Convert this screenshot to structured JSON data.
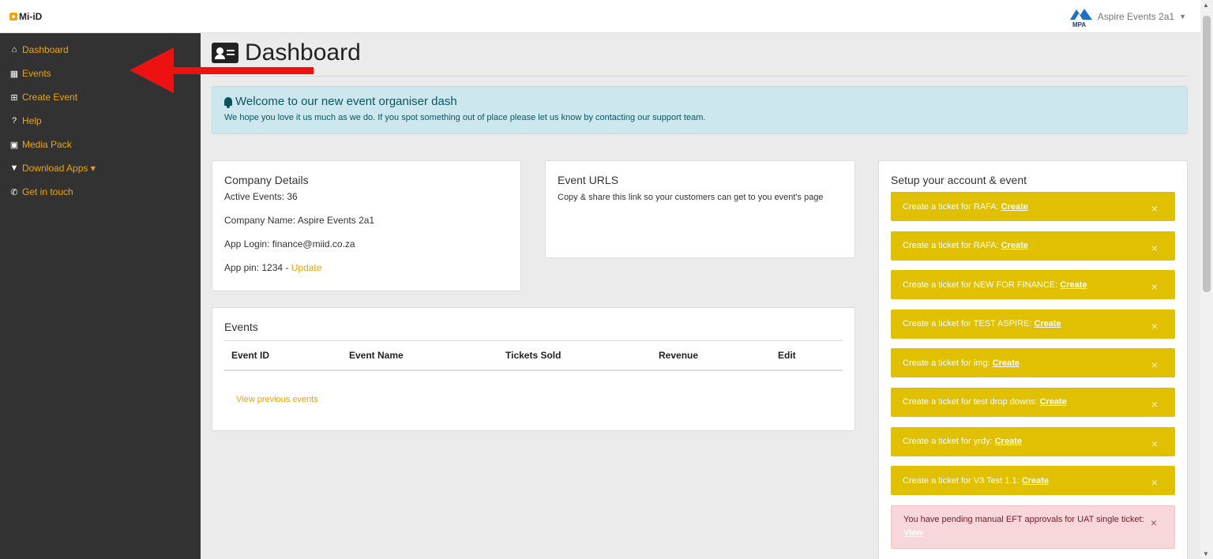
{
  "brand": {
    "name": "Mi-iD"
  },
  "account": {
    "name": "Aspire Events 2a1",
    "logo_text": "MPA"
  },
  "sidebar": {
    "items": [
      {
        "label": "Dashboard",
        "icon": "home-icon"
      },
      {
        "label": "Events",
        "icon": "calendar-icon"
      },
      {
        "label": "Create Event",
        "icon": "plus-square-icon"
      },
      {
        "label": "Help",
        "icon": "question-circle-icon"
      },
      {
        "label": "Media Pack",
        "icon": "images-icon"
      },
      {
        "label": "Download Apps ▾",
        "icon": "file-download-icon"
      },
      {
        "label": "Get in touch",
        "icon": "phone-icon"
      }
    ]
  },
  "page": {
    "title": "Dashboard"
  },
  "welcome": {
    "heading": "Welcome to our new event organiser dash",
    "text": "We hope you love it us much as we do. If you spot something out of place please let us know by contacting our support team."
  },
  "company": {
    "title": "Company Details",
    "active_events": "Active Events: 36",
    "company_name": "Company Name: Aspire Events 2a1",
    "app_login": "App Login: finance@miid.co.za",
    "app_pin": "App pin: 1234 - ",
    "update_link": "Update"
  },
  "urls": {
    "title": "Event URLS",
    "text": "Copy & share this link so your customers can get to you event's page"
  },
  "events": {
    "title": "Events",
    "columns": [
      "Event ID",
      "Event Name",
      "Tickets Sold",
      "Revenue",
      "Edit"
    ],
    "view_previous": "View previous events"
  },
  "setup": {
    "title": "Setup your account & event",
    "tasks": [
      {
        "text": "Create a ticket for RAFA:",
        "cta": "Create"
      },
      {
        "text": "Create a ticket for RAFA:",
        "cta": "Create"
      },
      {
        "text": "Create a ticket for NEW FOR FINANCE:",
        "cta": "Create"
      },
      {
        "text": "Create a ticket for TEST ASPIRE:",
        "cta": "Create"
      },
      {
        "text": "Create a ticket for img:",
        "cta": "Create"
      },
      {
        "text": "Create a ticket for test drop downs:",
        "cta": "Create"
      },
      {
        "text": "Create a ticket for yrdy:",
        "cta": "Create"
      },
      {
        "text": "Create a ticket for V3 Test 1.1:",
        "cta": "Create"
      }
    ],
    "pending": {
      "text": "You have pending manual EFT approvals for UAT single ticket: ",
      "cta": "View"
    },
    "close_glyph": "×"
  },
  "colors": {
    "accent": "#f0a500",
    "sidebar": "#323232",
    "task": "#e0c000",
    "annotation_arrow": "#ee1111"
  }
}
